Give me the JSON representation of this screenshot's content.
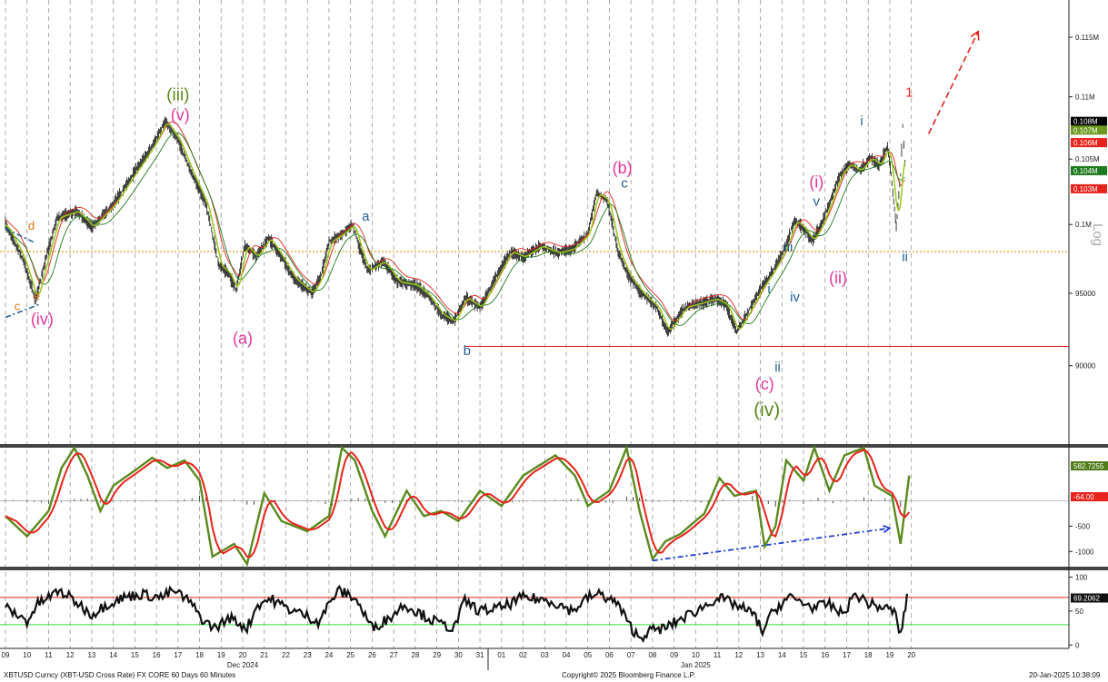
{
  "footer": {
    "left": "XBTUSD Curncy (XBT-USD Cross Rate) FX CORE 60 Days 60 Minutes",
    "center": "Copyright© 2025 Bloomberg Finance L.P.",
    "right": "20-Jan-2025 10:38:09"
  },
  "chart_data": [
    {
      "type": "line",
      "panel": "price",
      "scale": "log",
      "ylim": [
        85000,
        118000
      ],
      "yticks": [
        90000,
        95000,
        100000,
        105000,
        110000,
        115000
      ],
      "ytick_labels": [
        "90000",
        "95000",
        "0.1M",
        "0.105M",
        "0.11M",
        "0.115M"
      ],
      "ylabel": "Log",
      "x_day_labels": [
        "09",
        "10",
        "11",
        "12",
        "13",
        "14",
        "15",
        "16",
        "17",
        "18",
        "19",
        "20",
        "21",
        "22",
        "23",
        "24",
        "25",
        "26",
        "27",
        "28",
        "29",
        "30",
        "31",
        "01",
        "02",
        "03",
        "04",
        "05",
        "06",
        "07",
        "08",
        "09",
        "10",
        "11",
        "12",
        "13",
        "14",
        "15",
        "16",
        "17",
        "18",
        "19",
        "20"
      ],
      "x_month_labels": [
        {
          "label": "Dec 2024",
          "day_index": 11
        },
        {
          "label": "Jan 2025",
          "day_index": 32
        }
      ],
      "price_path": [
        [
          0,
          100000
        ],
        [
          0.8,
          97500
        ],
        [
          1.4,
          94500
        ],
        [
          1.8,
          97000
        ],
        [
          2.4,
          100500
        ],
        [
          3.3,
          101000
        ],
        [
          4,
          99800
        ],
        [
          5,
          101500
        ],
        [
          6,
          104000
        ],
        [
          6.8,
          106000
        ],
        [
          7.4,
          108000
        ],
        [
          8,
          106500
        ],
        [
          8.6,
          104000
        ],
        [
          9.3,
          101500
        ],
        [
          9.9,
          97000
        ],
        [
          10.3,
          96500
        ],
        [
          10.7,
          95200
        ],
        [
          11.1,
          98500
        ],
        [
          11.6,
          97600
        ],
        [
          12.2,
          99000
        ],
        [
          12.7,
          97800
        ],
        [
          13.4,
          96000
        ],
        [
          14.2,
          95000
        ],
        [
          14.6,
          96100
        ],
        [
          15,
          98700
        ],
        [
          15.6,
          99300
        ],
        [
          16.1,
          100000
        ],
        [
          16.4,
          98300
        ],
        [
          16.8,
          96600
        ],
        [
          17.5,
          97300
        ],
        [
          18.2,
          95800
        ],
        [
          19,
          95600
        ],
        [
          19.6,
          94800
        ],
        [
          20.2,
          93500
        ],
        [
          20.8,
          93000
        ],
        [
          21.3,
          94700
        ],
        [
          22,
          94000
        ],
        [
          22.7,
          96000
        ],
        [
          23.4,
          98000
        ],
        [
          24,
          97600
        ],
        [
          24.8,
          98400
        ],
        [
          25.6,
          97900
        ],
        [
          26.3,
          98200
        ],
        [
          27,
          99300
        ],
        [
          27.4,
          102400
        ],
        [
          27.9,
          101800
        ],
        [
          28.4,
          98000
        ],
        [
          28.9,
          96200
        ],
        [
          29.5,
          95000
        ],
        [
          30.2,
          94000
        ],
        [
          30.7,
          92300
        ],
        [
          31.5,
          94000
        ],
        [
          32.2,
          94300
        ],
        [
          32.9,
          94600
        ],
        [
          33.4,
          94200
        ],
        [
          33.9,
          92300
        ],
        [
          34.4,
          93600
        ],
        [
          35,
          95300
        ],
        [
          35.5,
          96400
        ],
        [
          36,
          97800
        ],
        [
          36.6,
          100300
        ],
        [
          37,
          99700
        ],
        [
          37.4,
          98800
        ],
        [
          37.8,
          99900
        ],
        [
          38.2,
          101600
        ],
        [
          38.7,
          103800
        ],
        [
          39.1,
          104600
        ],
        [
          39.6,
          104100
        ],
        [
          40.1,
          105100
        ],
        [
          40.5,
          104500
        ],
        [
          40.9,
          106000
        ],
        [
          41.1,
          103200
        ],
        [
          41.3,
          99800
        ],
        [
          41.5,
          103800
        ],
        [
          41.6,
          107700
        ],
        [
          41.7,
          104600
        ]
      ],
      "horizontal_lines": [
        {
          "value": 98000,
          "style": "orange-dotted"
        },
        {
          "value": 91300,
          "style": "red-solid"
        }
      ],
      "price_tags": [
        {
          "label": "0.108M",
          "value": 108000,
          "color": "#000000"
        },
        {
          "label": "0.107M",
          "value": 107300,
          "color": "#6b9a1e"
        },
        {
          "label": "0.106M",
          "value": 106300,
          "color": "#e8231b"
        },
        {
          "label": "0.104M",
          "value": 104100,
          "color": "#1e7a1e"
        },
        {
          "label": "0.103M",
          "value": 102700,
          "color": "#e8231b"
        }
      ],
      "wave_labels": [
        {
          "text": "(iii)",
          "x": 8,
          "y": 109700,
          "color": "#5a8a1e",
          "size": 19
        },
        {
          "text": "(v)",
          "x": 8.1,
          "y": 108100,
          "color": "#e8359a",
          "size": 18
        },
        {
          "text": "d",
          "x": 1.2,
          "y": 99600,
          "color": "#e07010",
          "size": 13
        },
        {
          "text": "c",
          "x": 0.55,
          "y": 93800,
          "color": "#e07010",
          "size": 13
        },
        {
          "text": "e",
          "x": 1.45,
          "y": 94500,
          "color": "#e07010",
          "size": 13
        },
        {
          "text": "(iv)",
          "x": 1.7,
          "y": 92800,
          "color": "#e8359a",
          "size": 18
        },
        {
          "text": "(a)",
          "x": 11,
          "y": 91500,
          "color": "#e8359a",
          "size": 18
        },
        {
          "text": "a",
          "x": 16.7,
          "y": 100300,
          "color": "#1f5f9a",
          "size": 15
        },
        {
          "text": "b",
          "x": 21.4,
          "y": 90700,
          "color": "#1f5f9a",
          "size": 15
        },
        {
          "text": "(b)",
          "x": 28.6,
          "y": 103900,
          "color": "#e8359a",
          "size": 18
        },
        {
          "text": "c",
          "x": 28.7,
          "y": 102800,
          "color": "#1f5f9a",
          "size": 15
        },
        {
          "text": "(c)",
          "x": 35.2,
          "y": 88400,
          "color": "#e8359a",
          "size": 18
        },
        {
          "text": "(iv)",
          "x": 35.3,
          "y": 86700,
          "color": "#5a8a1e",
          "size": 21
        },
        {
          "text": "i",
          "x": 35.4,
          "y": 95000,
          "color": "#1f5f9a",
          "size": 15
        },
        {
          "text": "ii",
          "x": 35.8,
          "y": 89600,
          "color": "#1f5f9a",
          "size": 15
        },
        {
          "text": "iii",
          "x": 36.3,
          "y": 98000,
          "color": "#1f5f9a",
          "size": 15
        },
        {
          "text": "iv",
          "x": 36.6,
          "y": 94400,
          "color": "#1f5f9a",
          "size": 15
        },
        {
          "text": "v",
          "x": 37.6,
          "y": 101400,
          "color": "#1f5f9a",
          "size": 15
        },
        {
          "text": "(i)",
          "x": 37.6,
          "y": 102800,
          "color": "#e8359a",
          "size": 18
        },
        {
          "text": "(ii)",
          "x": 38.6,
          "y": 95700,
          "color": "#e8359a",
          "size": 18
        },
        {
          "text": "i",
          "x": 39.7,
          "y": 107700,
          "color": "#1f5f9a",
          "size": 15
        },
        {
          "text": "1",
          "x": 41.9,
          "y": 110000,
          "color": "#e8231b",
          "size": 15
        },
        {
          "text": "ii",
          "x": 41.7,
          "y": 97300,
          "color": "#1f5f9a",
          "size": 15
        }
      ],
      "projection_arrow": {
        "from": [
          42.8,
          107000
        ],
        "to": [
          45.1,
          115500
        ],
        "color": "#e8231b",
        "style": "dashed"
      },
      "trendline_left": {
        "points": [
          [
            0,
            93300
          ],
          [
            1.55,
            94200
          ]
        ],
        "color": "#1f5f9a",
        "style": "dash-dot"
      },
      "trendline_left_upper": {
        "points": [
          [
            0,
            99700
          ],
          [
            1.3,
            98700
          ]
        ],
        "color": "#1f5f9a",
        "style": "dash-dot"
      }
    },
    {
      "type": "line",
      "panel": "oscillator",
      "ylim": [
        -1300,
        1050
      ],
      "yticks": [
        -500,
        -1000
      ],
      "ytick_labels": [
        "-500",
        "-1000"
      ],
      "zero_line": 0,
      "latest_values": [
        {
          "label": "582.7255",
          "color": "#4f7d1a"
        },
        {
          "label": "-64.00",
          "color": "#e8231b"
        }
      ],
      "path": [
        [
          0,
          -300
        ],
        [
          1,
          -700
        ],
        [
          2,
          -200
        ],
        [
          2.6,
          650
        ],
        [
          3.2,
          1050
        ],
        [
          3.8,
          500
        ],
        [
          4.4,
          -200
        ],
        [
          5,
          300
        ],
        [
          6,
          600
        ],
        [
          6.8,
          850
        ],
        [
          7.5,
          650
        ],
        [
          8.3,
          800
        ],
        [
          9,
          400
        ],
        [
          9.6,
          -1100
        ],
        [
          10.6,
          -850
        ],
        [
          11.2,
          -1250
        ],
        [
          12,
          150
        ],
        [
          12.8,
          -400
        ],
        [
          14,
          -600
        ],
        [
          15,
          -300
        ],
        [
          15.6,
          1050
        ],
        [
          16.2,
          800
        ],
        [
          17,
          -200
        ],
        [
          17.6,
          -700
        ],
        [
          18.6,
          200
        ],
        [
          19.4,
          -300
        ],
        [
          20.2,
          -200
        ],
        [
          21,
          -400
        ],
        [
          22,
          200
        ],
        [
          23,
          -100
        ],
        [
          24,
          500
        ],
        [
          25.5,
          900
        ],
        [
          26.4,
          500
        ],
        [
          27,
          -100
        ],
        [
          28,
          200
        ],
        [
          28.8,
          1050
        ],
        [
          29.4,
          -200
        ],
        [
          30,
          -1150
        ],
        [
          30.6,
          -800
        ],
        [
          31.3,
          -650
        ],
        [
          32.4,
          -250
        ],
        [
          33.1,
          450
        ],
        [
          33.8,
          100
        ],
        [
          34.8,
          200
        ],
        [
          35.2,
          -900
        ],
        [
          35.7,
          -500
        ],
        [
          36.2,
          800
        ],
        [
          37,
          400
        ],
        [
          37.5,
          1050
        ],
        [
          38.2,
          200
        ],
        [
          38.9,
          900
        ],
        [
          39.8,
          1050
        ],
        [
          40.3,
          300
        ],
        [
          41.1,
          100
        ],
        [
          41.5,
          -850
        ],
        [
          41.9,
          500
        ]
      ],
      "divergence_arrow": {
        "from": [
          30,
          -1180
        ],
        "to": [
          41,
          -540
        ],
        "color": "#1f3fd0",
        "style": "dash-dot"
      }
    },
    {
      "type": "line",
      "panel": "rsi",
      "ylim": [
        -5,
        110
      ],
      "yticks": [
        0,
        50,
        100
      ],
      "ytick_labels": [
        "0",
        "50",
        "100"
      ],
      "levels": [
        {
          "value": 70,
          "color": "#e8231b"
        },
        {
          "value": 30,
          "color": "#3ddc3d"
        }
      ],
      "latest_value": "69.2062",
      "path": [
        [
          0,
          55
        ],
        [
          1,
          35
        ],
        [
          1.5,
          60
        ],
        [
          2.5,
          80
        ],
        [
          3.2,
          65
        ],
        [
          4,
          45
        ],
        [
          4.7,
          60
        ],
        [
          5.5,
          70
        ],
        [
          6.3,
          75
        ],
        [
          7.2,
          70
        ],
        [
          7.8,
          80
        ],
        [
          8.5,
          65
        ],
        [
          9.2,
          35
        ],
        [
          9.7,
          25
        ],
        [
          10.4,
          40
        ],
        [
          11.2,
          25
        ],
        [
          11.7,
          60
        ],
        [
          12.3,
          68
        ],
        [
          13,
          55
        ],
        [
          13.8,
          45
        ],
        [
          14.5,
          35
        ],
        [
          15.4,
          80
        ],
        [
          16.2,
          70
        ],
        [
          17,
          25
        ],
        [
          17.8,
          40
        ],
        [
          18.5,
          60
        ],
        [
          19.3,
          45
        ],
        [
          20.2,
          30
        ],
        [
          20.8,
          25
        ],
        [
          21.3,
          65
        ],
        [
          22,
          50
        ],
        [
          23,
          55
        ],
        [
          24,
          70
        ],
        [
          25.3,
          65
        ],
        [
          26.3,
          50
        ],
        [
          27,
          70
        ],
        [
          27.6,
          75
        ],
        [
          28.4,
          60
        ],
        [
          28.9,
          30
        ],
        [
          29.4,
          10
        ],
        [
          29.8,
          20
        ],
        [
          30.6,
          25
        ],
        [
          31.4,
          40
        ],
        [
          32.3,
          55
        ],
        [
          33,
          70
        ],
        [
          33.8,
          60
        ],
        [
          34.7,
          45
        ],
        [
          35.1,
          20
        ],
        [
          35.6,
          50
        ],
        [
          36.3,
          70
        ],
        [
          36.8,
          65
        ],
        [
          37.5,
          55
        ],
        [
          38.2,
          60
        ],
        [
          38.8,
          45
        ],
        [
          39.4,
          75
        ],
        [
          40.1,
          60
        ],
        [
          40.7,
          55
        ],
        [
          41.2,
          50
        ],
        [
          41.5,
          15
        ],
        [
          41.8,
          69
        ]
      ]
    }
  ]
}
